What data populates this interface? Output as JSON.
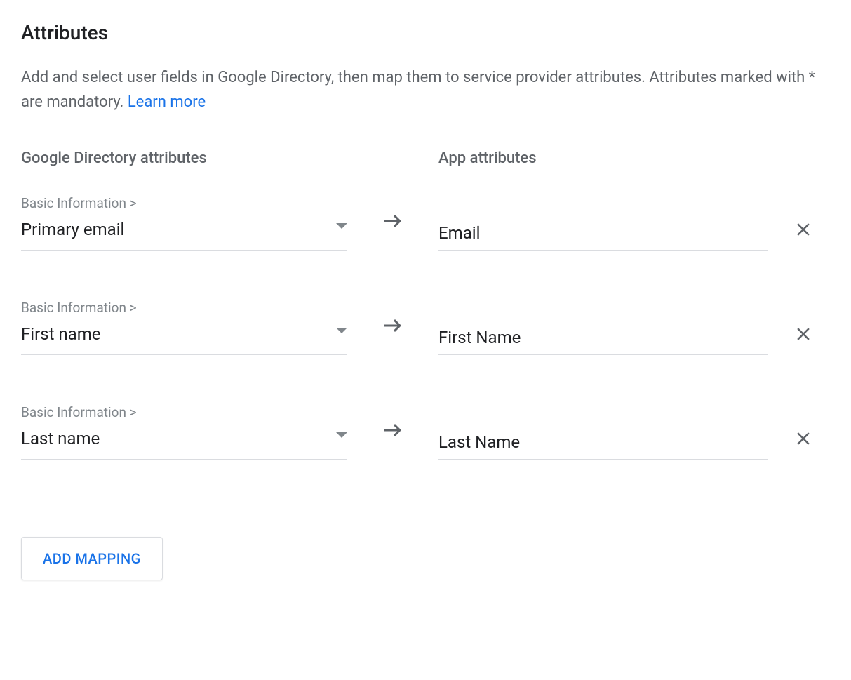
{
  "section": {
    "title": "Attributes",
    "description_pre": "Add and select user fields in Google Directory, then map them to service provider attributes. Attributes marked with * are mandatory. ",
    "learn_more": "Learn more"
  },
  "columns": {
    "left": "Google Directory attributes",
    "right": "App attributes"
  },
  "mappings": [
    {
      "category": "Basic Information >",
      "directory_value": "Primary email",
      "app_value": "Email"
    },
    {
      "category": "Basic Information >",
      "directory_value": "First name",
      "app_value": "First Name"
    },
    {
      "category": "Basic Information >",
      "directory_value": "Last name",
      "app_value": "Last Name"
    }
  ],
  "add_mapping_label": "ADD MAPPING"
}
